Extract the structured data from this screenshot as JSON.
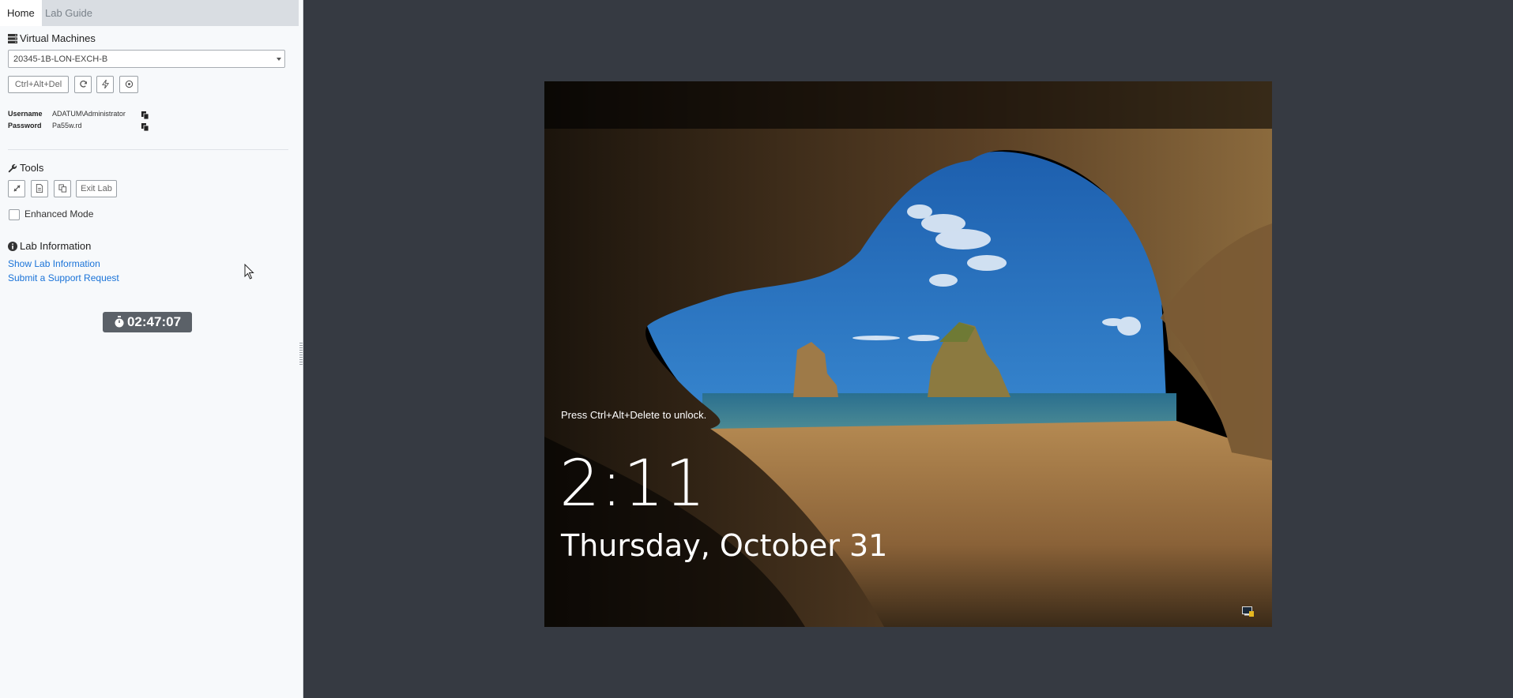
{
  "tabs": [
    {
      "label": "Home",
      "active": true
    },
    {
      "label": "Lab Guide",
      "active": false
    }
  ],
  "vm": {
    "heading": "Virtual Machines",
    "selected": "20345-1B-LON-EXCH-B",
    "buttons": {
      "ctrl_alt_del": "Ctrl+Alt+Del",
      "icons": [
        "refresh-icon",
        "power-icon",
        "reset-icon"
      ]
    }
  },
  "credentials": {
    "username_label": "Username",
    "username_value": "ADATUM\\Administrator",
    "password_label": "Password",
    "password_value": "Pa55w.rd"
  },
  "tools": {
    "heading": "Tools",
    "icons": [
      "resize-icon",
      "document-icon",
      "copy-icon"
    ],
    "exit_label": "Exit Lab",
    "enhanced_mode_label": "Enhanced Mode",
    "enhanced_mode_checked": false
  },
  "lab_info": {
    "heading": "Lab Information",
    "links": [
      "Show Lab Information",
      "Submit a Support Request"
    ]
  },
  "timer": {
    "value": "02:47:07",
    "icon": "stopwatch-icon"
  },
  "remote_screen": {
    "unlock_hint": "Press Ctrl+Alt+Delete to unlock.",
    "time": "2:11",
    "date": "Thursday, October 31",
    "tray_icon": "network-icon"
  },
  "colors": {
    "background": "#363a42",
    "link": "#1a73d8",
    "timer_bg": "#5b6168"
  }
}
